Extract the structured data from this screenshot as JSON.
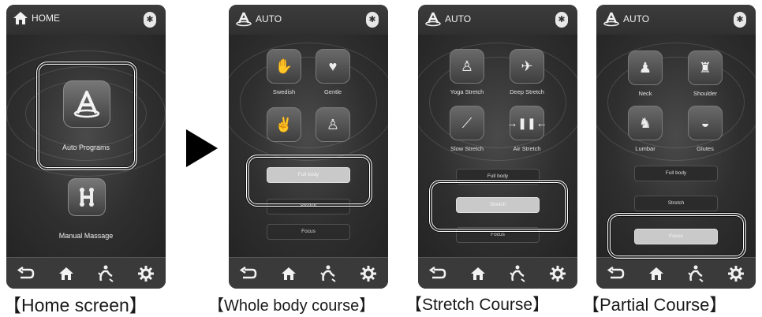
{
  "screens": {
    "home": {
      "title": "HOME",
      "auto_label": "Auto Programs",
      "manual_label": "Manual Massage",
      "caption": "【Home screen】"
    },
    "whole": {
      "title": "AUTO",
      "tiles": [
        "Swedish",
        "Gentle",
        "",
        ""
      ],
      "courses": [
        "Full body",
        "Stretch",
        "Focus"
      ],
      "caption": "【Whole body course】"
    },
    "stretch": {
      "title": "AUTO",
      "tiles": [
        "Yoga Stretch",
        "Deep Stretch",
        "Slow Stretch",
        "Air Stretch"
      ],
      "courses": [
        "Full body",
        "Stretch",
        "Focus"
      ],
      "caption": "【Stretch Course】"
    },
    "partial": {
      "title": "AUTO",
      "tiles": [
        "Neck",
        "Shoulder",
        "Lumbar",
        "Glutes"
      ],
      "courses": [
        "Full body",
        "Stretch",
        "Focus"
      ],
      "caption": "【Partial Course】"
    }
  },
  "icons": {
    "bluetooth": "bluetooth-icon",
    "back": "back-icon",
    "home": "home-icon",
    "massage": "massage-icon",
    "settings": "gear-icon"
  },
  "colors": {
    "screen_bg": "#2f2f2f",
    "selected_button": "#c9c9c9",
    "highlight": "#ffffff"
  }
}
